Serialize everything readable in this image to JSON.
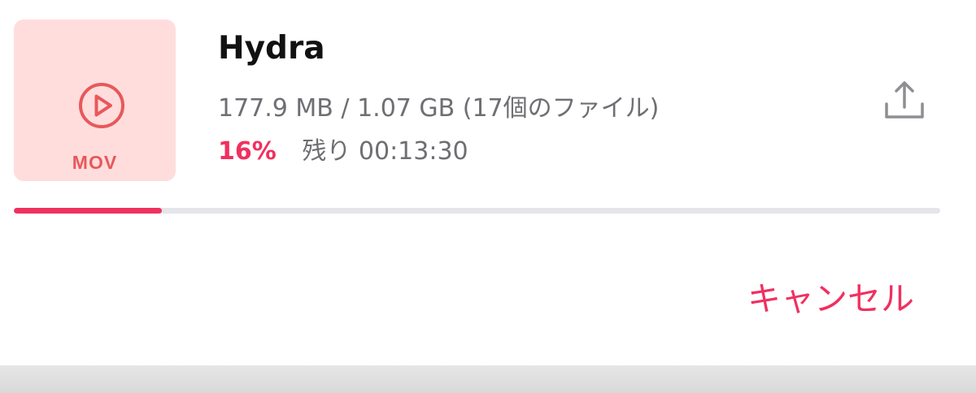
{
  "file": {
    "name": "Hydra",
    "format": "MOV",
    "size_text": "177.9 MB / 1.07 GB (17個のファイル)",
    "percent_text": "16%",
    "remaining_text": "残り 00:13:30",
    "progress_fraction": 0.16
  },
  "actions": {
    "cancel_label": "キャンセル"
  },
  "icons": {
    "play": "play-circle-icon",
    "share": "share-upload-icon"
  },
  "colors": {
    "accent": "#f0305f",
    "thumbnail_bg": "#ffdddd",
    "thumbnail_fg": "#e8585a",
    "secondary_text": "#6e6e73",
    "track": "#e5e5ea"
  }
}
